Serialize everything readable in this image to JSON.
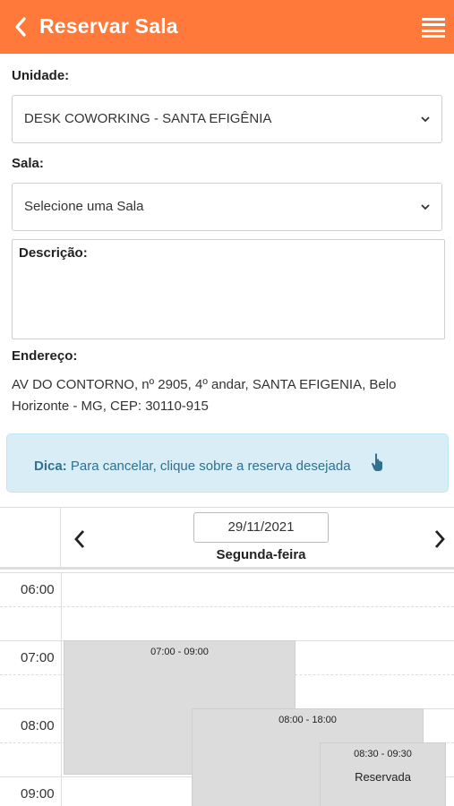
{
  "header": {
    "title": "Reservar Sala",
    "back_icon": "chevron-left-icon",
    "menu_icon": "hamburger-menu-icon"
  },
  "form": {
    "unit_label": "Unidade:",
    "unit_value": "DESK COWORKING - SANTA EFIGÊNIA",
    "room_label": "Sala:",
    "room_value": "Selecione uma Sala",
    "description_label": "Descrição:",
    "address_label": "Endereço:",
    "address_value": "AV DO CONTORNO, nº 2905, 4º andar, SANTA EFIGENIA, Belo Horizonte - MG, CEP: 30110-915"
  },
  "tip": {
    "label": "Dica:",
    "text": "Para cancelar, clique sobre a reserva desejada",
    "icon": "tap-hand-icon"
  },
  "calendar": {
    "date": "29/11/2021",
    "weekday": "Segunda-feira",
    "times": [
      "06:00",
      "07:00",
      "08:00",
      "09:00"
    ],
    "events": [
      {
        "time": "07:00 - 09:00",
        "status": ""
      },
      {
        "time": "08:00 - 18:00",
        "status": ""
      },
      {
        "time": "08:30 - 09:30",
        "status": "Reservada"
      }
    ]
  },
  "colors": {
    "header": "#ff7a3a",
    "tip_bg": "#d9edf7",
    "tip_text": "#31708f",
    "event_bg": "#dcdcdc"
  }
}
